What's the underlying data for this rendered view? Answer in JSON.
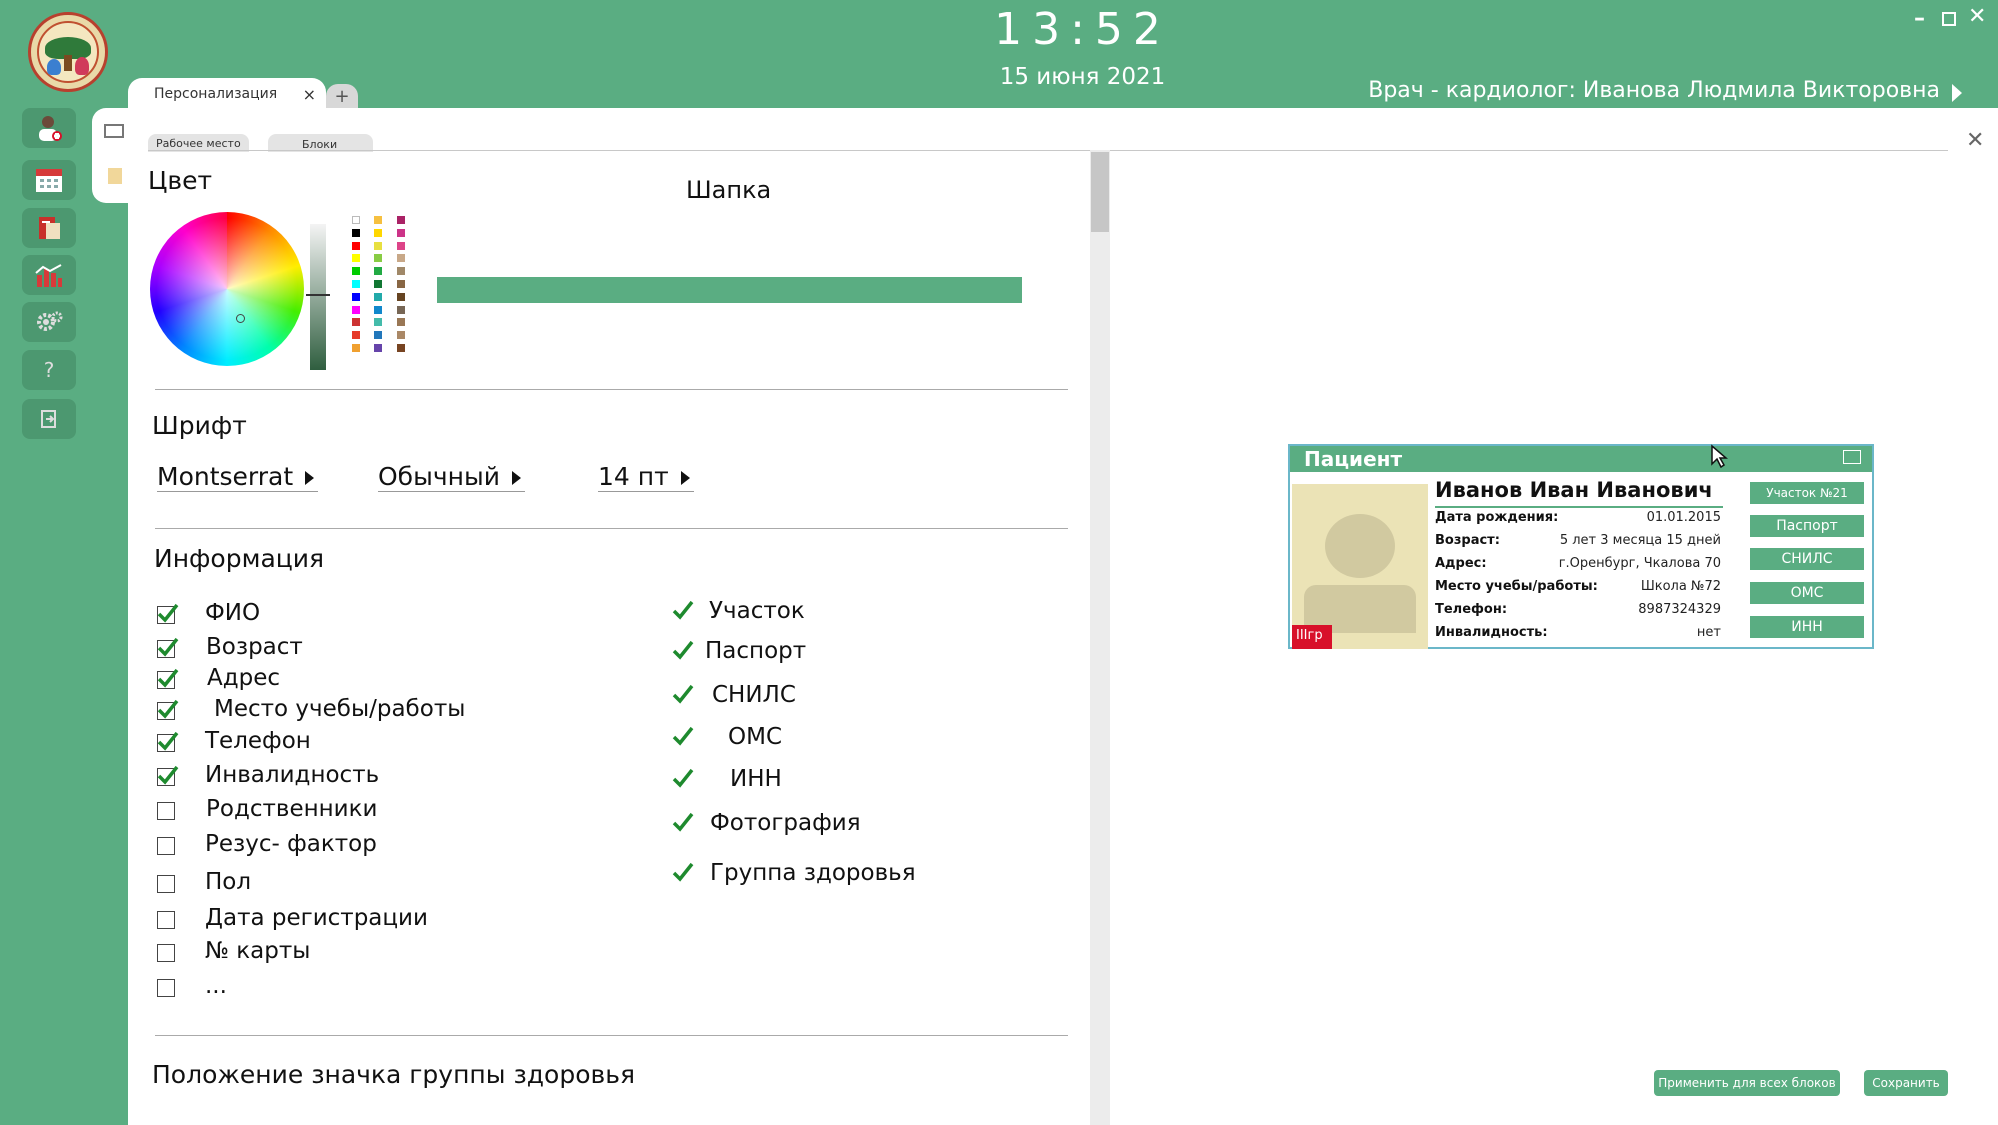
{
  "header": {
    "time": "13:52",
    "date": "15 июня 2021",
    "user": "Врач - кардиолог: Иванова Людмила Викторовна"
  },
  "tabs": {
    "active_label": "Персонализация",
    "close": "×",
    "add": "+"
  },
  "subtabs": [
    "Рабочее место",
    "Блоки"
  ],
  "color_section": {
    "title": "Цвет",
    "preview_title": "Шапка",
    "header_color": "#5aad82",
    "palette": [
      [
        "#ffffff",
        "#000000",
        "#ff0000",
        "#ffff00",
        "#00cc00",
        "#00ffff",
        "#0000ff",
        "#ff00ff",
        "#cc3333",
        "#e63a2a",
        "#f0a030"
      ],
      [
        "#f6c040",
        "#ffd700",
        "#e8e040",
        "#88cc44",
        "#22aa44",
        "#117733",
        "#22aaaa",
        "#1188cc",
        "#44bbaa",
        "#2277bb",
        "#6644aa"
      ],
      [
        "#aa2266",
        "#cc3388",
        "#dd4488",
        "#c8a888",
        "#a08868",
        "#886644",
        "#664422",
        "#776655",
        "#997755",
        "#aa8866",
        "#774422"
      ]
    ]
  },
  "font_section": {
    "title": "Шрифт",
    "family": "Montserrat",
    "style": "Обычный",
    "size": "14 пт"
  },
  "info_section": {
    "title": "Информация",
    "left": [
      {
        "label": "ФИО",
        "checked": true
      },
      {
        "label": "Возраст",
        "checked": true
      },
      {
        "label": "Адрес",
        "checked": true
      },
      {
        "label": "Место учебы/работы",
        "checked": true
      },
      {
        "label": "Телефон",
        "checked": true
      },
      {
        "label": "Инвалидность",
        "checked": true
      },
      {
        "label": "Родственники",
        "checked": false
      },
      {
        "label": "Резус- фактор",
        "checked": false
      },
      {
        "label": "Пол",
        "checked": false
      },
      {
        "label": "Дата регистрации",
        "checked": false
      },
      {
        "label": "№ карты",
        "checked": false
      },
      {
        "label": "...",
        "checked": false
      }
    ],
    "right": [
      {
        "label": "Участок",
        "checked": true
      },
      {
        "label": "Паспорт",
        "checked": true
      },
      {
        "label": "СНИЛС",
        "checked": true
      },
      {
        "label": "ОМС",
        "checked": true
      },
      {
        "label": "ИНН",
        "checked": true
      },
      {
        "label": "Фотография",
        "checked": true
      },
      {
        "label": "Группа здоровья",
        "checked": true
      }
    ]
  },
  "badge_section": {
    "title": "Положение значка группы здоровья"
  },
  "patient_card": {
    "title": "Пациент",
    "name": "Иванов Иван Иванович",
    "health_badge": "IIIгр",
    "fields": [
      {
        "label": "Дата рождения:",
        "value": "01.01.2015"
      },
      {
        "label": "Возраст:",
        "value": "5 лет 3 месяца 15 дней"
      },
      {
        "label": "Адрес:",
        "value": "г.Оренбург, Чкалова 70"
      },
      {
        "label": "Место учебы/работы:",
        "value": "Школа №72"
      },
      {
        "label": "Телефон:",
        "value": "8987324329"
      },
      {
        "label": "Инвалидность:",
        "value": "нет"
      }
    ],
    "buttons": [
      "Участок №21",
      "Паспорт",
      "СНИЛС",
      "ОМС",
      "ИНН"
    ]
  },
  "actions": {
    "apply_all": "Применить для всех блоков",
    "save": "Сохранить"
  }
}
